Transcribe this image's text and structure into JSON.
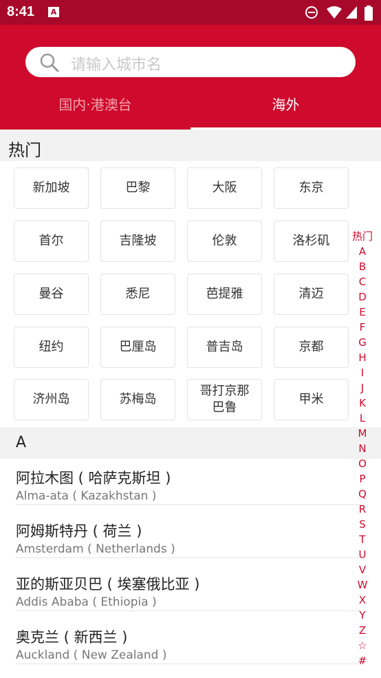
{
  "status_bar": {
    "time": "8:41",
    "app_glyph": "A"
  },
  "search": {
    "placeholder": "请输入城市名"
  },
  "tabs": [
    {
      "label": "国内·港澳台",
      "selected": false
    },
    {
      "label": "海外",
      "selected": true
    }
  ],
  "hot": {
    "title": "热门",
    "cities": [
      "新加坡",
      "巴黎",
      "大阪",
      "东京",
      "首尔",
      "吉隆坡",
      "伦敦",
      "洛杉矶",
      "曼谷",
      "悉尼",
      "芭提雅",
      "清迈",
      "纽约",
      "巴厘岛",
      "普吉岛",
      "京都",
      "济州岛",
      "苏梅岛",
      "哥打京那巴鲁",
      "甲米"
    ]
  },
  "sections": [
    {
      "letter": "A",
      "cities": [
        {
          "cn": "阿拉木图 ( 哈萨克斯坦 )",
          "en": "Alma-ata ( Kazakhstan )"
        },
        {
          "cn": "阿姆斯特丹 ( 荷兰 )",
          "en": "Amsterdam ( Netherlands )"
        },
        {
          "cn": "亚的斯亚贝巴 ( 埃塞俄比亚 )",
          "en": "Addis Ababa ( Ethiopia )"
        },
        {
          "cn": "奥克兰 ( 新西兰 )",
          "en": "Auckland ( New Zealand )"
        }
      ]
    }
  ],
  "index": [
    "热门",
    "A",
    "B",
    "C",
    "D",
    "E",
    "F",
    "G",
    "H",
    "I",
    "J",
    "K",
    "L",
    "M",
    "N",
    "O",
    "P",
    "Q",
    "R",
    "S",
    "T",
    "U",
    "V",
    "W",
    "X",
    "Y",
    "Z",
    "☆",
    "#"
  ],
  "colors": {
    "brand_red": "#cf0a2c",
    "status_bar": "#a8082a",
    "tab_inactive": "#f2a1ad"
  }
}
